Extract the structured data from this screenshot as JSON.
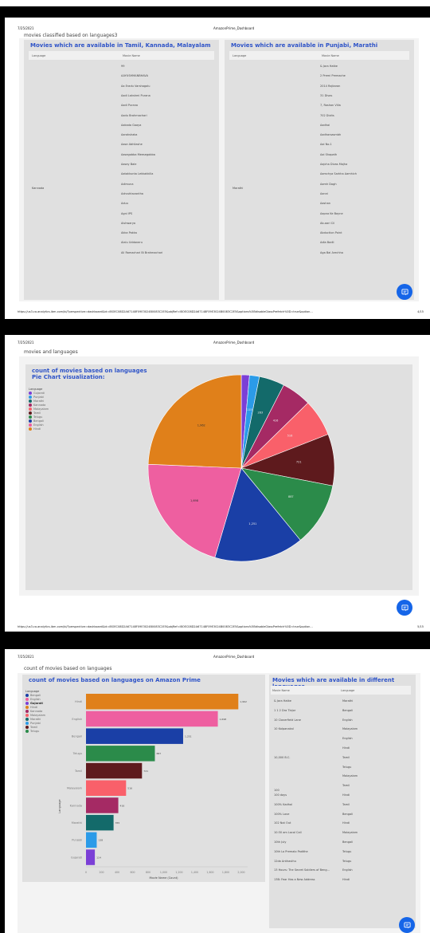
{
  "app_title": "AmazonPrime_Dashboard",
  "date": "7/25/2021",
  "pages": [
    {
      "title": "movies classified based on languages3",
      "footer_url": "https://us3.ca.analytics.ibm.com/bi/?perspective=dashboard&id=iBOEC08D2A67148F09E3024B0083C2E5&objRef=iBOEC08D2A67148F09E3024B0083C2E5&options%5BdisableGlassPrefetch%5D=true&option...",
      "page_number": "4/15",
      "left_table": {
        "title": "Movies which are available in Tamil, Kannada, Malayalam",
        "headers": [
          "Language",
          "Movie Name"
        ],
        "language": "Kannada",
        "movies": [
          "99",
          "AAYUSHMANBHAVA",
          "Aa Eradu Varshagalu",
          "Aadi Lakshmi Purana",
          "Aadi Purana",
          "Aadu Brahmachari",
          "Aakada Gaaya",
          "Aarakshaka",
          "Aase Abhilashe",
          "Aasegobba Meesegobba",
          "Aasey Bale",
          "Aatakkunta Lekkakkilla",
          "Adimuna",
          "Adrushtavantha",
          "Aduu",
          "Agni IPS",
          "Aishwarya",
          "Akka Pakka",
          "Alalu Uddaneru",
          "Ali Ramachari Bi Brahmachari"
        ]
      },
      "right_table": {
        "title": "Movies which are available in Punjabi, Marathi",
        "headers": [
          "Language",
          "Movie Name"
        ],
        "language": "Marathi",
        "movies": [
          "& Jara Hatke",
          "2 Premi Premache",
          "2014 Rajkaran",
          "31 Divas",
          "7, Roshan Villa",
          "702 Dixits",
          "Aadhai",
          "Aadharsasmbh",
          "Aai No.1",
          "Aai Shapath",
          "Aajcha Divas Majha",
          "Aamchya Sarkha Aamhich",
          "Aamh Dogh",
          "Aanni",
          "Aashan",
          "Aapna Ke Bayne",
          "Ab-aari Cil",
          "Abduction Point",
          "Adla Badli",
          "Aga Bai Arechha"
        ]
      }
    },
    {
      "title": "movies and languages",
      "footer_url": "https://us3.ca.analytics.ibm.com/bi/?perspective=dashboard&id=iBOEC08D2A67148F09E3024B0083C2E5&objRef=iBOEC08D2A67148F09E3024B0083C2E5&options%5BdisableGlassPrefetch%5D=true&option...",
      "page_number": "5/15",
      "chart_title": [
        "count of movies based on languages",
        "Pie Chart visualization:"
      ],
      "legend_title": "Language",
      "legend": [
        "Gujarati",
        "Punjabi",
        "Marathi",
        "Kannada",
        "Malayalam",
        "Tamil",
        "Telugu",
        "Bengali",
        "English",
        "Hindi"
      ]
    },
    {
      "title": "count of movies based on languages",
      "chart_title": "count of movies based on languages on Amazon Prime",
      "legend_title": "Language",
      "legend": [
        "Bengali",
        "English",
        "Gujarati",
        "Hindi",
        "Kannada",
        "Malayalam",
        "Marathi",
        "Punjabi",
        "Tamil",
        "Telugu"
      ],
      "y_label": "Language",
      "x_label": "Movie Name (Count)",
      "table": {
        "title": "Movies which are available in different languages",
        "headers": [
          "Movie Name",
          "Language"
        ],
        "rows": [
          [
            "& Jara Hatke",
            "Marathi"
          ],
          [
            "1 1 2 Dra Tlejor",
            "Bengali"
          ],
          [
            "10 Cloverfield Lane",
            "English"
          ],
          [
            "10 Kalpanakal",
            "Malayalam"
          ],
          [
            "",
            "English"
          ],
          [
            "10,000 B.C.",
            "Hindi"
          ],
          [
            "",
            "Tamil"
          ],
          [
            "",
            "Telugu"
          ],
          [
            "",
            "Malayalam"
          ],
          [
            "100",
            "Tamil"
          ],
          [
            "100 days",
            "Hindi"
          ],
          [
            "100% Kadhal",
            "Tamil"
          ],
          [
            "100% Love",
            "Bengali"
          ],
          [
            "102 Not Out",
            "Hindi"
          ],
          [
            "10:30 am Local Call",
            "Malayalam"
          ],
          [
            "10th July",
            "Bengali"
          ],
          [
            "10th Lo Premalo Padithe",
            "Telugu"
          ],
          [
            "12da Anthasthu",
            "Telugu"
          ],
          [
            "13 Hours: The Secret Soldiers of Beng...",
            "English"
          ],
          [
            "13B: Fear Has a New Address",
            "Hindi"
          ]
        ]
      }
    }
  ],
  "colors": {
    "Gujarati": "#7b3fd6",
    "Punjabi": "#2b9be8",
    "Marathi": "#136a6a",
    "Kannada": "#a52a64",
    "Malayalam": "#f9606a",
    "Tamil": "#5e1a1d",
    "Telugu": "#2b8b4a",
    "Bengali": "#1a3fa6",
    "English": "#ee5fa0",
    "Hindi": "#e0801a",
    "title_blue": "#2f54c8",
    "chat_blue": "#1565e8"
  },
  "chart_data": [
    {
      "type": "pie",
      "title": "count of movies based on languages Pie Chart visualization:",
      "legend_position": "left",
      "categories": [
        "Gujarati",
        "Punjabi",
        "Marathi",
        "Kannada",
        "Malayalam",
        "Tamil",
        "Telugu",
        "Bengali",
        "English",
        "Hindi"
      ],
      "values": [
        114,
        138,
        355,
        416,
        516,
        721,
        887,
        1251,
        1698,
        1962
      ],
      "labels": [
        "",
        "115",
        "283",
        "416",
        "516",
        "721",
        "887",
        "1,251",
        "1,698",
        "1,962"
      ]
    },
    {
      "type": "bar",
      "orientation": "horizontal",
      "title": "count of movies based on languages on Amazon Prime",
      "xlabel": "Movie Name (Count)",
      "ylabel": "Language",
      "xlim": [
        0,
        2000
      ],
      "xticks": [
        "0",
        "200",
        "400",
        "600",
        "800",
        "1,000",
        "1,200",
        "1,400",
        "1,600",
        "1,800",
        "2,000"
      ],
      "categories": [
        "Hindi",
        "English",
        "Bengali",
        "Telugu",
        "Tamil",
        "Malayalam",
        "Kannada",
        "Marathi",
        "Punjabi",
        "Gujarati"
      ],
      "values": [
        1962,
        1698,
        1251,
        887,
        721,
        516,
        416,
        355,
        138,
        114
      ],
      "labels": [
        "1,962",
        "1,698",
        "1,251",
        "887",
        "721",
        "516",
        "416",
        "355",
        "138",
        "114"
      ]
    }
  ]
}
